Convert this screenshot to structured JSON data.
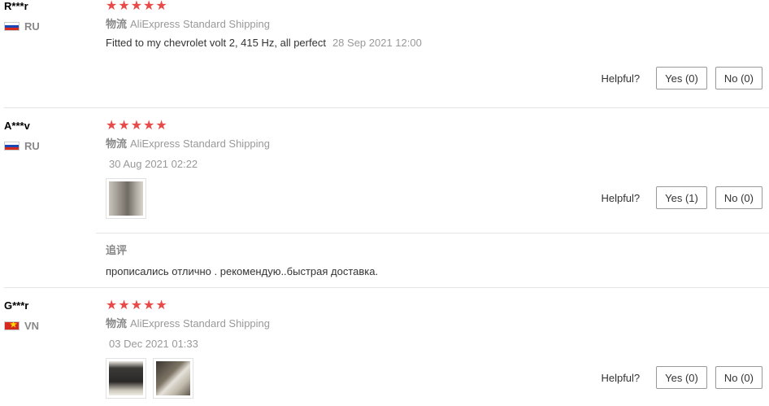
{
  "helpful_label": "Helpful?",
  "reviews": [
    {
      "user": "R***r",
      "country": "RU",
      "stars": "★★★★★",
      "shipping_prefix": "物流",
      "shipping": "AliExpress Standard Shipping",
      "text": "Fitted to my chevrolet volt 2, 415 Hz, all perfect",
      "date": "28 Sep 2021 12:00",
      "yes": "Yes (0)",
      "no": "No (0)"
    },
    {
      "user": "A***v",
      "country": "RU",
      "stars": "★★★★★",
      "shipping_prefix": "物流",
      "shipping": "AliExpress Standard Shipping",
      "date": "30 Aug 2021 02:22",
      "yes": "Yes (1)",
      "no": "No (0)",
      "followup_label": "追评",
      "followup_text": "прописались отлично . рекомендую..быстрая доставка."
    },
    {
      "user": "G***r",
      "country": "VN",
      "stars": "★★★★★",
      "shipping_prefix": "物流",
      "shipping": "AliExpress Standard Shipping",
      "date": "03 Dec 2021 01:33",
      "yes": "Yes (0)",
      "no": "No (0)"
    }
  ]
}
